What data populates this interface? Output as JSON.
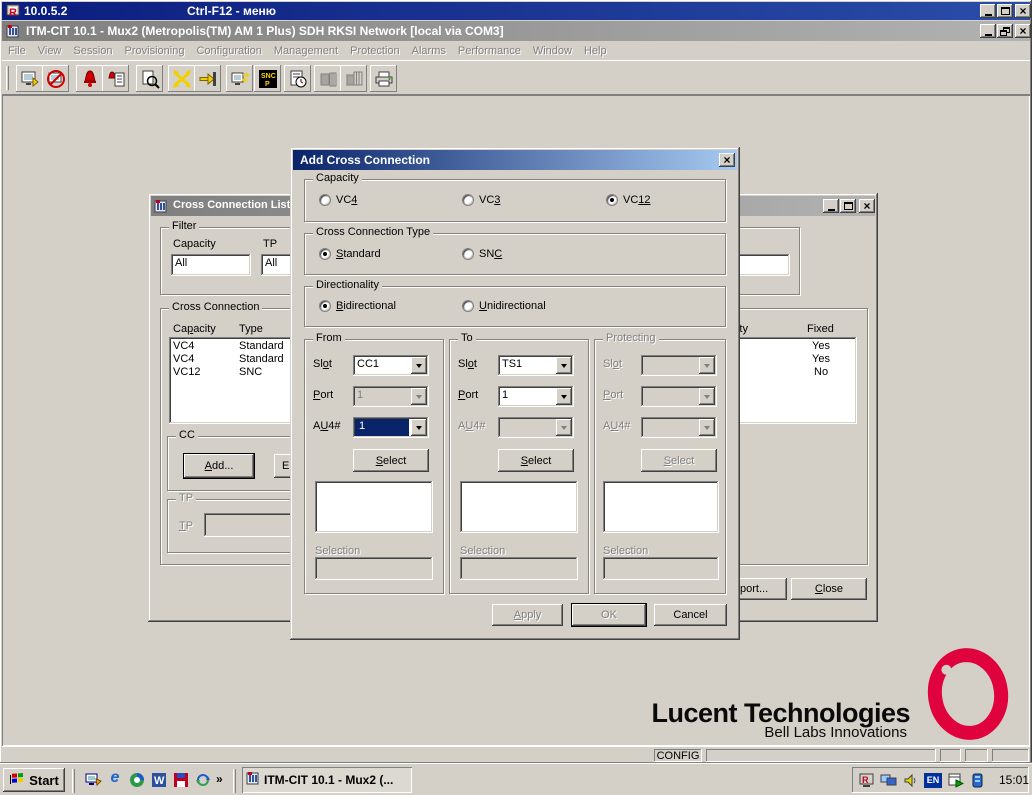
{
  "remote": {
    "ip": "10.0.5.2",
    "hint": "Ctrl-F12 - меню"
  },
  "app": {
    "title": "ITM-CIT 10.1 - Mux2 (Metropolis(TM) AM 1 Plus) SDH RKSI Network [local via COM3]",
    "menu": {
      "items": [
        "File",
        "View",
        "Session",
        "Provisioning",
        "Configuration",
        "Management",
        "Protection",
        "Alarms",
        "Performance",
        "Window",
        "Help"
      ]
    },
    "toolbar": {
      "icons": [
        "connect",
        "disconnect",
        "alarm-list",
        "alarm-log",
        "inspect",
        "cross-connect",
        "login",
        "network-element",
        "sncp",
        "performance",
        "slot-view",
        "rack-view",
        "print"
      ]
    },
    "statusbar": {
      "mode": "CONFIG"
    }
  },
  "list_window": {
    "title": "Cross Connection List -",
    "filter": {
      "legend": "Filter",
      "capacity_label": "Capacity",
      "capacity_value": "All",
      "tp_label": "TP",
      "tp_value": "All"
    },
    "list": {
      "legend": "Cross Connection",
      "headers": {
        "capacity": {
          "pre": "Ca",
          "u": "p",
          "post": "acity"
        },
        "type": "Type",
        "directionality": "Directionality",
        "fixed": "Fixed"
      },
      "rows": [
        {
          "capacity": "VC4",
          "type": "Standard",
          "fixed": "Yes"
        },
        {
          "capacity": "VC4",
          "type": "Standard",
          "fixed": "Yes"
        },
        {
          "capacity": "VC12",
          "type": "SNC",
          "fixed": "No"
        }
      ]
    },
    "cc": {
      "legend": "CC",
      "add": {
        "pre": "",
        "u": "A",
        "post": "dd..."
      },
      "edit_visible": "E"
    },
    "tp": {
      "legend": "TP",
      "label": {
        "pre": "",
        "u": "T",
        "post": "P"
      }
    },
    "buttons": {
      "export_visible": "port...",
      "close": {
        "pre": "",
        "u": "C",
        "post": "lose"
      }
    }
  },
  "dialog": {
    "title": "Add Cross Connection",
    "capacity": {
      "legend": "Capacity",
      "options": [
        {
          "pre": "VC",
          "u": "4",
          "post": "",
          "selected": false
        },
        {
          "pre": "VC",
          "u": "3",
          "post": "",
          "selected": false
        },
        {
          "pre": "VC",
          "u": "12",
          "post": "",
          "selected": true
        }
      ]
    },
    "type": {
      "legend": "Cross Connection Type",
      "options": [
        {
          "pre": "",
          "u": "S",
          "post": "tandard",
          "selected": true
        },
        {
          "pre": "SN",
          "u": "C",
          "post": "",
          "selected": false
        }
      ]
    },
    "directionality": {
      "legend": "Directionality",
      "options": [
        {
          "pre": "",
          "u": "B",
          "post": "idirectional",
          "selected": true
        },
        {
          "pre": "",
          "u": "U",
          "post": "nidirectional",
          "selected": false
        }
      ]
    },
    "labels": {
      "slot": {
        "pre": "Sl",
        "u": "o",
        "post": "t"
      },
      "port": {
        "pre": "",
        "u": "P",
        "post": "ort"
      },
      "au4": {
        "pre": "A",
        "u": "U",
        "post": "4#"
      },
      "select": {
        "pre": "",
        "u": "S",
        "post": "elect"
      },
      "selection": "Selection"
    },
    "from": {
      "legend": "From",
      "slot_value": "CC1",
      "port_value": "1",
      "au4_value": "1",
      "selection_value": ""
    },
    "to": {
      "legend": "To",
      "slot_value": "TS1",
      "port_value": "1",
      "au4_value": "",
      "selection_value": ""
    },
    "protecting": {
      "legend": "Protecting",
      "slot_value": "",
      "port_value": "",
      "au4_value": "",
      "selection_value": ""
    },
    "buttons": {
      "apply": {
        "pre": "",
        "u": "A",
        "post": "pply"
      },
      "ok": "OK",
      "cancel": "Cancel"
    }
  },
  "branding": {
    "name": "Lucent Technologies",
    "tagline": "Bell Labs Innovations"
  },
  "taskbar": {
    "start": "Start",
    "overflow": "»",
    "task": "ITM-CIT 10.1 - Mux2 (...",
    "language": "EN",
    "clock": "15:01"
  },
  "colors": {
    "title_active_from": "#0a246a",
    "title_active_to": "#a6caf0",
    "title_inactive_from": "#7f7f7f",
    "title_inactive_to": "#b2b2b2",
    "face": "#d4d0c8",
    "selection": "#0a246a",
    "lucent_red": "#df023c"
  }
}
